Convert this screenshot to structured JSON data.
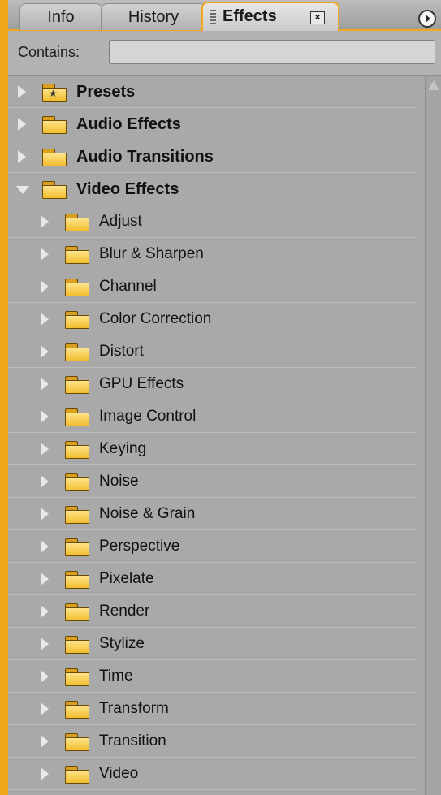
{
  "tabs": {
    "info": "Info",
    "history": "History",
    "effects": "Effects",
    "close_glyph": "×"
  },
  "search": {
    "label": "Contains:",
    "value": "",
    "placeholder": ""
  },
  "tree": {
    "top_items": [
      {
        "label": "Presets",
        "icon": "preset-folder-icon",
        "expanded": false
      },
      {
        "label": "Audio Effects",
        "icon": "folder-icon",
        "expanded": false
      },
      {
        "label": "Audio Transitions",
        "icon": "folder-icon",
        "expanded": false
      },
      {
        "label": "Video Effects",
        "icon": "folder-icon",
        "expanded": true
      }
    ],
    "video_children": [
      "Adjust",
      "Blur & Sharpen",
      "Channel",
      "Color Correction",
      "Distort",
      "GPU Effects",
      "Image Control",
      "Keying",
      "Noise",
      "Noise & Grain",
      "Perspective",
      "Pixelate",
      "Render",
      "Stylize",
      "Time",
      "Transform",
      "Transition",
      "Video"
    ]
  },
  "colors": {
    "accent": "#f2a81d",
    "panel_bg": "#a9a9a9",
    "folder": "#f2bd2e"
  }
}
